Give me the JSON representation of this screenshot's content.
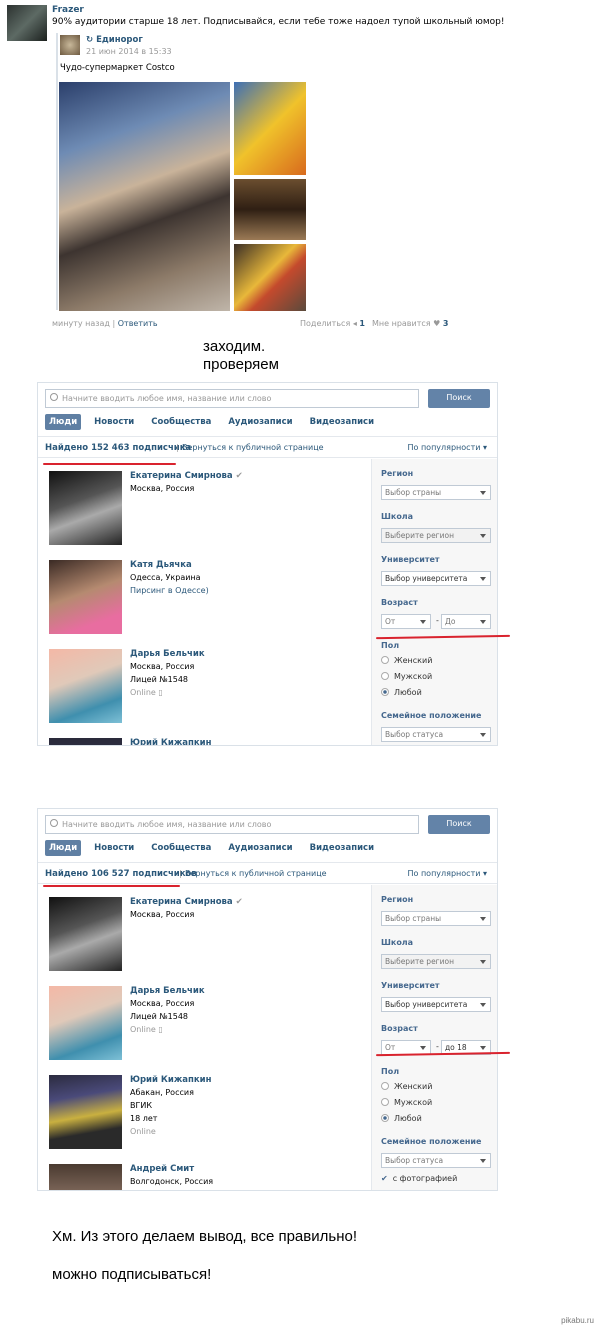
{
  "post": {
    "author": "Frazer",
    "text": "90% аудитории старше 18 лет. Подписывайся, если тебе тоже надоел тупой школьный юмор!",
    "repost": {
      "author": "Единорог",
      "date": "21 июн 2014 в 15:33",
      "text": "Чудо-супермаркет Costco"
    },
    "footer": {
      "time": "минуту назад",
      "reply": "Ответить",
      "share_label": "Поделиться",
      "share_count": "1",
      "like_label": "Мне нравится",
      "like_count": "3"
    }
  },
  "notes": {
    "line1": "заходим.",
    "line2": "проверяем",
    "conclusion": "Хм. Из этого делаем вывод, все правильно!",
    "final": "можно подписываться!"
  },
  "search": {
    "placeholder": "Начните вводить любое имя, название или слово",
    "button": "Поиск",
    "tabs": [
      "Люди",
      "Новости",
      "Сообщества",
      "Аудиозаписи",
      "Видеозаписи"
    ],
    "back": "Вернуться к публичной странице",
    "sort": "По популярности"
  },
  "panel1": {
    "found": "Найдено 152 463 подписчика",
    "people": [
      {
        "name": "Екатерина Смирнова",
        "l1": "Москва, Россия",
        "l2": "",
        "l3": "",
        "l4": ""
      },
      {
        "name": "Катя Дьячка",
        "l1": "Одесса, Украина",
        "l2": "Пирсинг в Одессе)",
        "l3": "",
        "l4": ""
      },
      {
        "name": "Дарья Бельчик",
        "l1": "Москва, Россия",
        "l2": "Лицей №1548",
        "l3": "Online",
        "l4": ""
      },
      {
        "name": "Юрий Кижапкин",
        "l1": "",
        "l2": "",
        "l3": "",
        "l4": ""
      }
    ],
    "filters": {
      "region_label": "Регион",
      "region_value": "Выбор страны",
      "school_label": "Школа",
      "school_value": "Выберите регион",
      "university_label": "Университет",
      "university_value": "Выбор университета",
      "age_label": "Возраст",
      "age_from": "От",
      "age_to": "До",
      "gender_label": "Пол",
      "gender_f": "Женский",
      "gender_m": "Мужской",
      "gender_any": "Любой",
      "status_label": "Семейное положение",
      "status_value": "Выбор статуса"
    }
  },
  "panel2": {
    "found": "Найдено 106 527 подписчиков",
    "people": [
      {
        "name": "Екатерина Смирнова",
        "l1": "Москва, Россия",
        "l2": "",
        "l3": "",
        "l4": ""
      },
      {
        "name": "Дарья Бельчик",
        "l1": "Москва, Россия",
        "l2": "Лицей №1548",
        "l3": "Online",
        "l4": ""
      },
      {
        "name": "Юрий Кижапкин",
        "l1": "Абакан, Россия",
        "l2": "ВГИК",
        "l3": "18 лет",
        "l4": "Online"
      },
      {
        "name": "Андрей Смит",
        "l1": "Волгодонск, Россия",
        "l2": "",
        "l3": "",
        "l4": ""
      }
    ],
    "filters": {
      "region_label": "Регион",
      "region_value": "Выбор страны",
      "school_label": "Школа",
      "school_value": "Выберите регион",
      "university_label": "Университет",
      "university_value": "Выбор университета",
      "age_label": "Возраст",
      "age_from": "От",
      "age_to": "до 18",
      "gender_label": "Пол",
      "gender_f": "Женский",
      "gender_m": "Мужской",
      "gender_any": "Любой",
      "status_label": "Семейное положение",
      "status_value": "Выбор статуса",
      "with_photo": "с фотографией"
    }
  },
  "watermark": "pikabu.ru"
}
